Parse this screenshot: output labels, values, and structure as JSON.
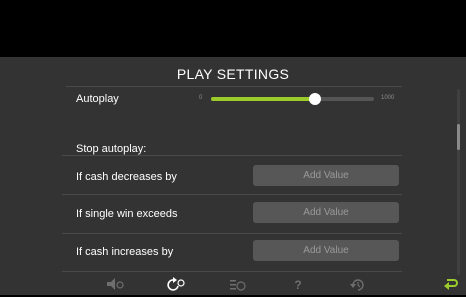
{
  "header": {
    "title": "PLAY SETTINGS"
  },
  "autoplay": {
    "label": "Autoplay",
    "min_label": "0",
    "max_label": "1000",
    "value_fraction": 0.64
  },
  "stop_autoplay": {
    "label": "Stop autoplay:",
    "rows": [
      {
        "label": "If cash decreases by",
        "button_label": "Add Value"
      },
      {
        "label": "If single win exceeds",
        "button_label": "Add Value"
      },
      {
        "label": "If cash increases by",
        "button_label": "Add Value"
      }
    ]
  },
  "bottom_nav": {
    "items": [
      {
        "icon": "sound-icon",
        "glyph": "◀)"
      },
      {
        "icon": "autoplay-settings-icon",
        "glyph": "↻"
      },
      {
        "icon": "paytable-icon",
        "glyph": "≡$"
      },
      {
        "icon": "help-icon",
        "glyph": "?"
      },
      {
        "icon": "history-icon",
        "glyph": "⟲"
      }
    ],
    "back_icon": "back-arrow-icon"
  },
  "colors": {
    "accent": "#9ccc2c",
    "panel_bg": "#333333",
    "button_bg": "#575757"
  }
}
